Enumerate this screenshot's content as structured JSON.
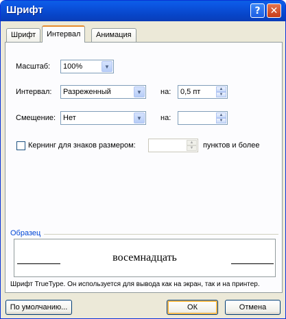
{
  "window": {
    "title": "Шрифт"
  },
  "titlebar": {
    "help_label": "?",
    "close_label": "✕"
  },
  "tabs": [
    {
      "label": "Шрифт"
    },
    {
      "label": "Интервал"
    },
    {
      "label": "Анимация"
    }
  ],
  "fields": {
    "scale_label": "Масштаб:",
    "scale_value": "100%",
    "spacing_label": "Интервал:",
    "spacing_value": "Разреженный",
    "spacing_by_label": "на:",
    "spacing_by_value": "0,5 пт",
    "position_label": "Смещение:",
    "position_value": "Нет",
    "position_by_label": "на:",
    "position_by_value": "",
    "kerning_label": "Кернинг для знаков размером:",
    "kerning_value": "",
    "kerning_suffix": "пунктов и более"
  },
  "preview": {
    "group_label": "Образец",
    "sample_text": "восемнадцать",
    "info": "Шрифт TrueType. Он используется для вывода как на экран, так и на принтер."
  },
  "buttons": {
    "default_label": "По умолчанию...",
    "ok_label": "ОК",
    "cancel_label": "Отмена"
  },
  "colors": {
    "titlebar": "#0a4fd8",
    "active_tab_accent": "#e68b2c",
    "group_label": "#0046d5"
  }
}
